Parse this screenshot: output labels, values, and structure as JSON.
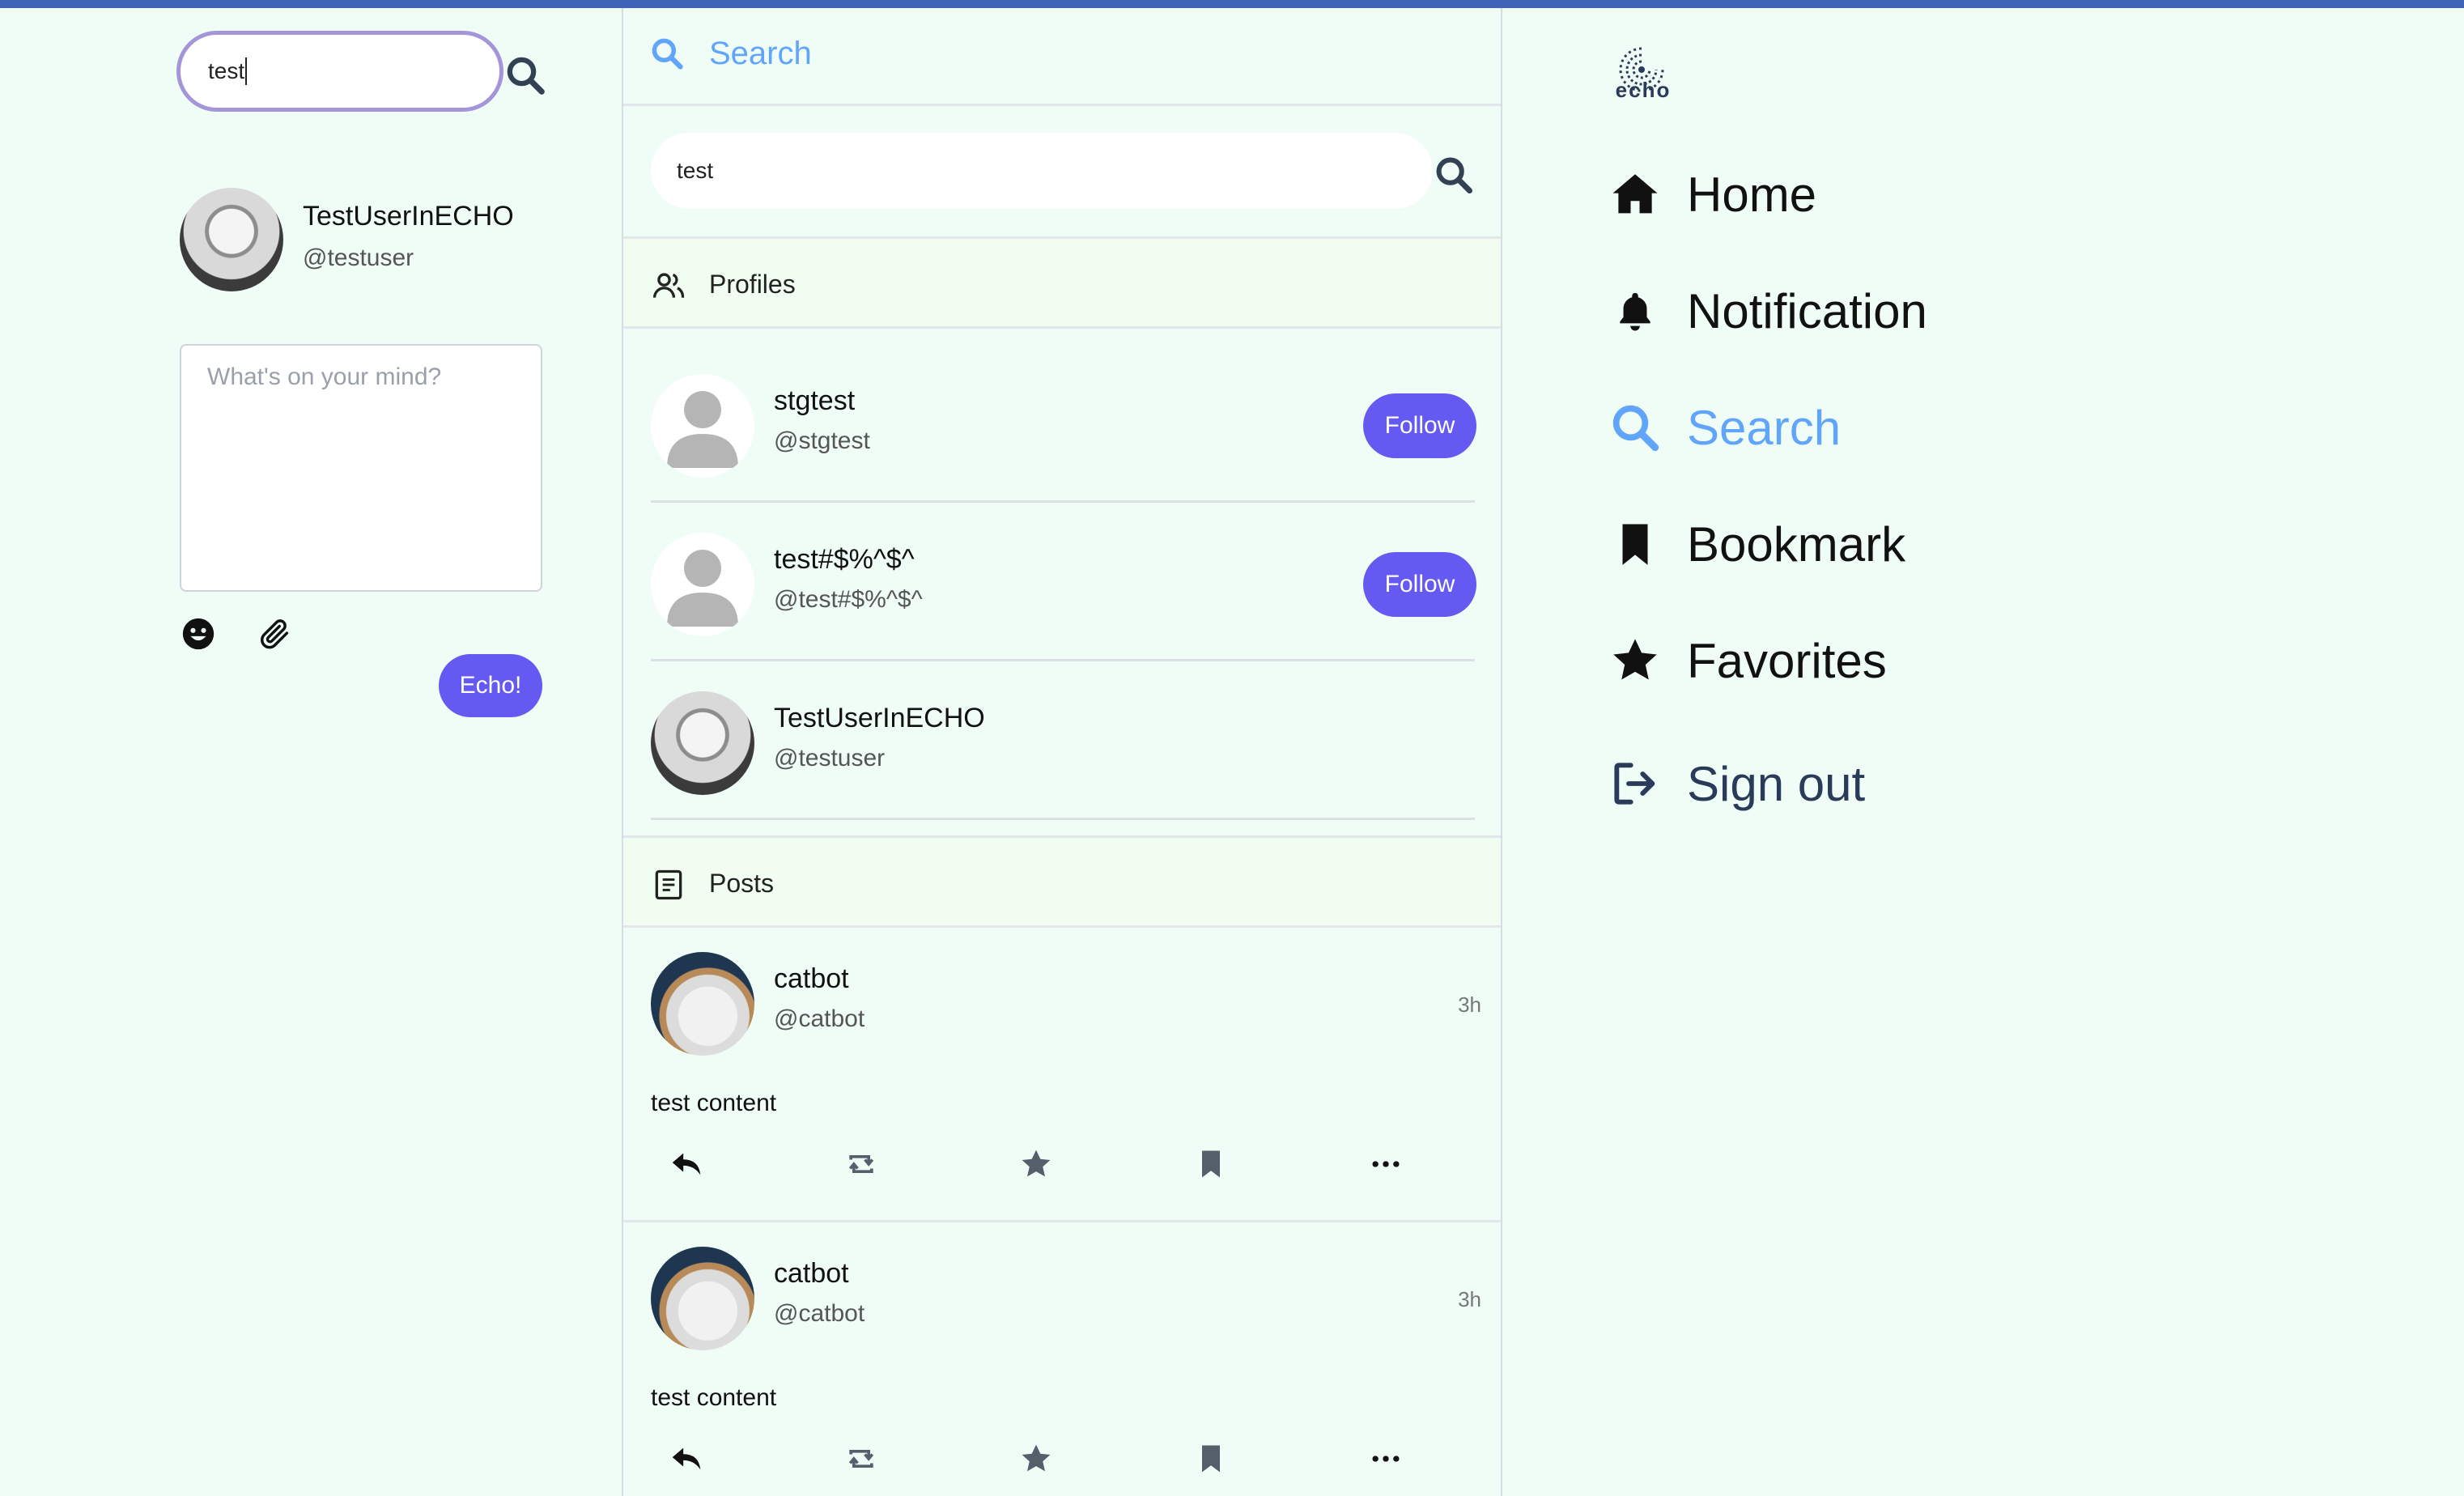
{
  "left": {
    "search": {
      "value": "test"
    },
    "user": {
      "name": "TestUserInECHO",
      "handle": "@testuser"
    },
    "compose": {
      "placeholder": "What's on your mind?",
      "submit_label": "Echo!"
    }
  },
  "middle": {
    "header_title": "Search",
    "search": {
      "value": "test"
    },
    "profiles_label": "Profiles",
    "profiles": [
      {
        "name": "stgtest",
        "handle": "@stgtest",
        "follow_label": "Follow"
      },
      {
        "name": "test#$%^$^",
        "handle": "@test#$%^$^",
        "follow_label": "Follow"
      },
      {
        "name": "TestUserInECHO",
        "handle": "@testuser"
      }
    ],
    "posts_label": "Posts",
    "posts": [
      {
        "name": "catbot",
        "handle": "@catbot",
        "time": "3h",
        "content": "test content"
      },
      {
        "name": "catbot",
        "handle": "@catbot",
        "time": "3h",
        "content": "test content"
      }
    ]
  },
  "right": {
    "logo_text": "echo",
    "nav": [
      {
        "label": "Home",
        "icon": "home-icon"
      },
      {
        "label": "Notification",
        "icon": "bell-icon"
      },
      {
        "label": "Search",
        "icon": "search-icon"
      },
      {
        "label": "Bookmark",
        "icon": "bookmark-icon"
      },
      {
        "label": "Favorites",
        "icon": "star-icon"
      },
      {
        "label": "Sign out",
        "icon": "sign-out-icon"
      }
    ]
  },
  "colors": {
    "page_bg": "#f0fdf7",
    "top_bar": "#3f63b7",
    "accent_button": "#6459f0",
    "active_nav": "#60a5fa",
    "section_bg": "#f0fdf0"
  }
}
